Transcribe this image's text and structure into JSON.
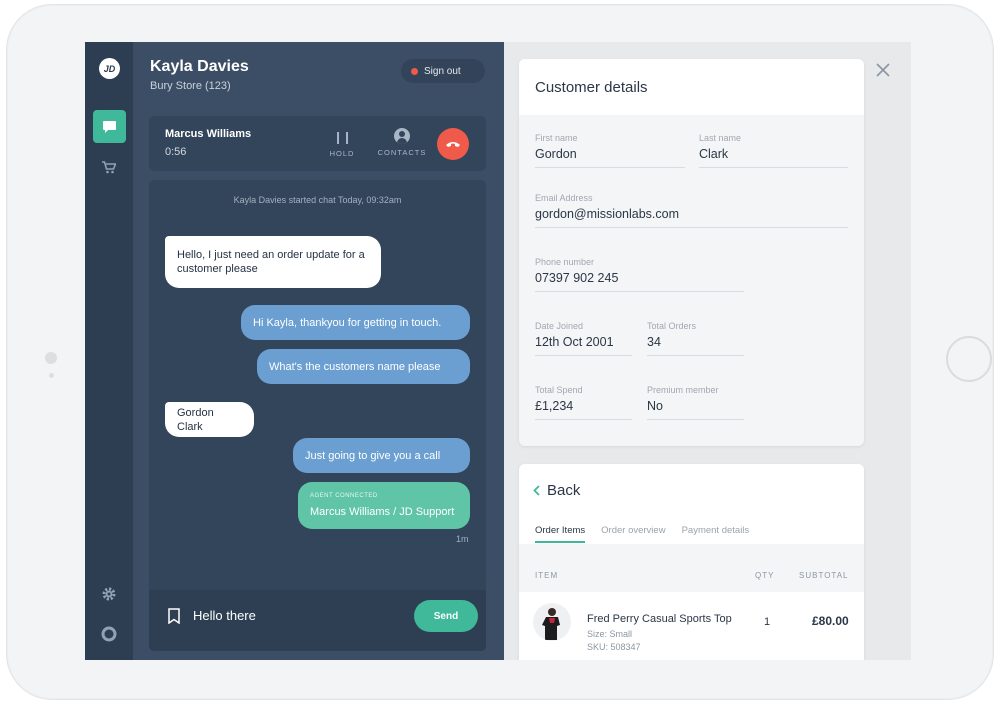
{
  "app": {
    "logo_text": "JD",
    "rail": {
      "chat_icon": "chat-bubble-icon",
      "cart_icon": "cart-icon",
      "settings_icon": "gear-icon",
      "support_icon": "lifebuoy-icon"
    }
  },
  "agent": {
    "name": "Kayla Davies",
    "store": "Bury Store (123)",
    "signout_label": "Sign out"
  },
  "call": {
    "caller": "Marcus Williams",
    "duration": "0:56",
    "hold_label": "HOLD",
    "contacts_label": "CONTACTS",
    "hangup_icon": "hang-up-icon"
  },
  "chat": {
    "system_message": "Kayla Davies started chat Today, 09:32am",
    "messages": [
      {
        "from": "customer",
        "text": "Hello, I just need an order update for a customer please"
      },
      {
        "from": "agent",
        "text": "Hi Kayla, thankyou for getting in touch."
      },
      {
        "from": "agent",
        "text": "What's the customers name please"
      },
      {
        "from": "customer",
        "text": "Gordon Clark"
      },
      {
        "from": "agent",
        "text": "Just going to give you a call"
      },
      {
        "from": "system",
        "tag": "AGENT CONNECTED",
        "text": "Marcus Williams / JD Support"
      }
    ],
    "last_time": "1m",
    "compose_value": "Hello there",
    "send_label": "Send"
  },
  "customer": {
    "title": "Customer details",
    "first_name": {
      "label": "First name",
      "value": "Gordon"
    },
    "last_name": {
      "label": "Last name",
      "value": "Clark"
    },
    "email": {
      "label": "Email Address",
      "value": "gordon@missionlabs.com"
    },
    "phone": {
      "label": "Phone number",
      "value": "07397 902 245"
    },
    "date_joined": {
      "label": "Date Joined",
      "value": "12th Oct 2001"
    },
    "total_orders": {
      "label": "Total Orders",
      "value": "34"
    },
    "total_spend": {
      "label": "Total Spend",
      "value": "£1,234"
    },
    "premium": {
      "label": "Premium member",
      "value": "No"
    }
  },
  "order": {
    "back_label": "Back",
    "tabs": [
      "Order Items",
      "Order overview",
      "Payment details"
    ],
    "active_tab": "Order Items",
    "columns": [
      "ITEM",
      "QTY",
      "SUBTOTAL"
    ],
    "items": [
      {
        "name": "Fred Perry Casual Sports Top",
        "size": "Size: Small",
        "sku": "SKU: 508347",
        "qty": "1",
        "subtotal": "£80.00"
      }
    ]
  },
  "colors": {
    "accent": "#3fb99a",
    "rail": "#2d3d52",
    "chat_panel": "#3c4e65",
    "agent_bubble": "#6b9fd1",
    "hangup": "#ef5a4a"
  }
}
